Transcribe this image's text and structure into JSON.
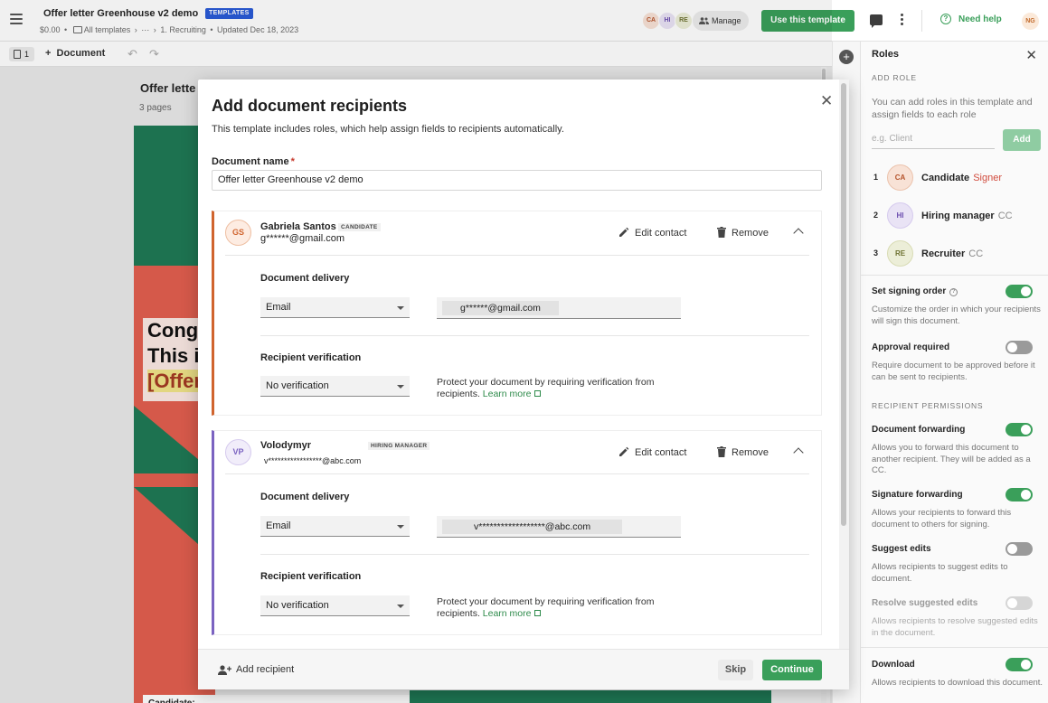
{
  "header": {
    "doc_title": "Offer letter Greenhouse v2 demo",
    "templates_badge": "TEMPLATES",
    "price": "$0.00",
    "breadcrumb_all": "All templates",
    "breadcrumb_more": "⋯",
    "breadcrumb_folder": "1. Recruiting",
    "updated": "Updated Dec 18, 2023",
    "avatars": [
      "CA",
      "HI",
      "RE"
    ],
    "manage_label": "Manage",
    "use_template_label": "Use this template",
    "help_label": "Need help",
    "user_initials": "NG"
  },
  "editor": {
    "page_count": "1",
    "document_label": "Document",
    "canvas_title": "Offer lette",
    "canvas_pages": "3 pages",
    "headline": "Cong This i",
    "headline_line1": "Cong",
    "headline_line2": "This i",
    "headline_line3": "[Offer",
    "candidate_label": "Candidate:"
  },
  "panel": {
    "title": "Roles",
    "add_role_label": "ADD ROLE",
    "add_role_help": "You can add roles in this template and assign fields to each role",
    "role_placeholder": "e.g. Client",
    "add_button": "Add",
    "roles": [
      {
        "num": "1",
        "initials": "CA",
        "name": "Candidate",
        "type": "Signer"
      },
      {
        "num": "2",
        "initials": "HI",
        "name": "Hiring manager",
        "type": "CC"
      },
      {
        "num": "3",
        "initials": "RE",
        "name": "Recruiter",
        "type": "CC"
      }
    ],
    "signing_order_title": "Set signing order",
    "signing_order_desc": "Customize the order in which your recipients will sign this document.",
    "approval_title": "Approval required",
    "approval_desc": "Require document to be approved before it can be sent to recipients.",
    "permissions_label": "RECIPIENT PERMISSIONS",
    "doc_forwarding_title": "Document forwarding",
    "doc_forwarding_desc": "Allows you to forward this document to another recipient. They will be added as a CC.",
    "sig_forwarding_title": "Signature forwarding",
    "sig_forwarding_desc": "Allows your recipients to forward this document to others for signing.",
    "suggest_title": "Suggest edits",
    "suggest_desc": "Allows recipients to suggest edits to document.",
    "resolve_title": "Resolve suggested edits",
    "resolve_desc": "Allows recipients to resolve suggested edits in the document.",
    "download_title": "Download",
    "download_desc": "Allows recipients to download this document."
  },
  "modal": {
    "title": "Add document recipients",
    "subtitle": "This template includes roles, which help assign fields to recipients automatically.",
    "doc_name_label": "Document name",
    "required_mark": "*",
    "doc_name_value": "Offer letter Greenhouse v2 demo",
    "edit_contact": "Edit contact",
    "remove": "Remove",
    "delivery_label": "Document delivery",
    "verification_label": "Recipient verification",
    "protect_text": "Protect your document by requiring verification from recipients.",
    "learn_more": "Learn more",
    "recipients": [
      {
        "initials": "GS",
        "name": "Gabriela Santos",
        "role_tag": "CANDIDATE",
        "email": "g******@gmail.com",
        "delivery": "Email",
        "delivery_email": "g******@gmail.com",
        "verification": "No verification"
      },
      {
        "initials": "VP",
        "name": "Volodymyr",
        "role_tag": "HIRING MANAGER",
        "email": "v*****************@abc.com",
        "delivery": "Email",
        "delivery_email": "v******************@abc.com",
        "verification": "No verification"
      }
    ],
    "add_recipient": "Add recipient",
    "skip": "Skip",
    "continue": "Continue"
  },
  "colors": {
    "accent_green": "#3a9f5a",
    "candidate_orange": "#d0642e",
    "manager_purple": "#7b63c1",
    "signer_red": "#d14b3d"
  }
}
